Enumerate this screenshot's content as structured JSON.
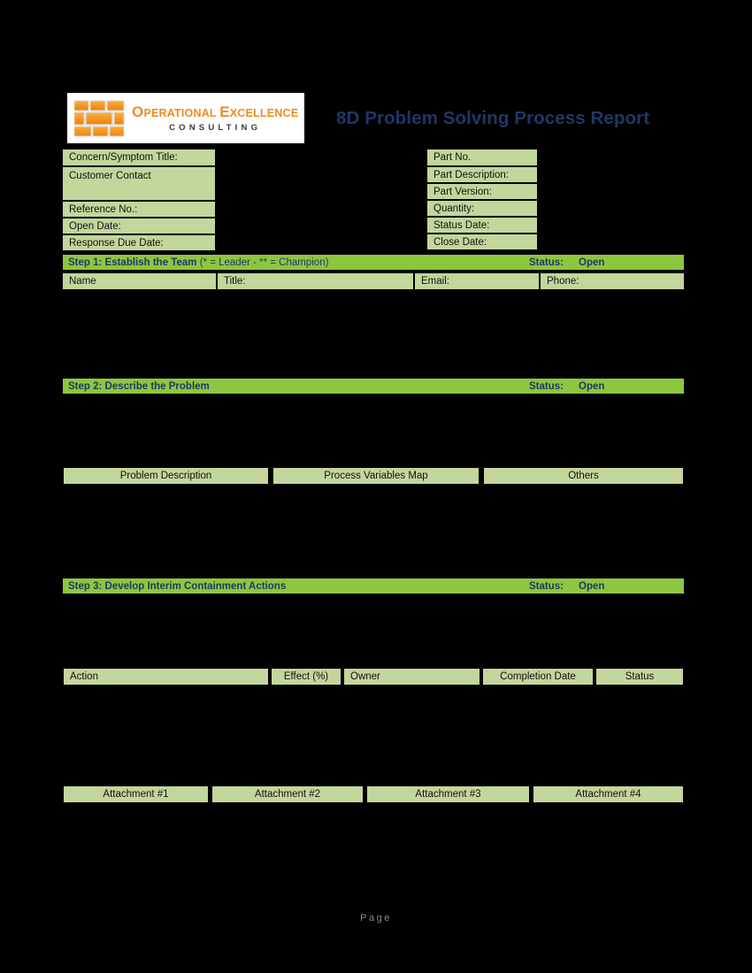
{
  "header": {
    "logo": {
      "company_line1_a": "O",
      "company_line1_b": "PERATIONAL ",
      "company_line1_c": "E",
      "company_line1_d": "XCELLENCE",
      "company_line2": "CONSULTING",
      "brand_color": "#F18A1E"
    },
    "report_title": "8D Problem Solving Process Report",
    "title_color": "#1F3864"
  },
  "info_left": [
    {
      "label": "Concern/Symptom Title:"
    },
    {
      "label": "Customer Contact"
    },
    {
      "label": "Reference No.:"
    },
    {
      "label": "Open Date:"
    },
    {
      "label": "Response Due Date:"
    }
  ],
  "info_right": [
    {
      "label": "Part No."
    },
    {
      "label": "Part Description:"
    },
    {
      "label": "Part Version:"
    },
    {
      "label": "Quantity:"
    },
    {
      "label": "Status Date:"
    },
    {
      "label": "Close Date:"
    }
  ],
  "steps": {
    "step1": {
      "title": "Step 1: Establish the Team ",
      "note": "(* = Leader - ** = Champion)",
      "status_label": "Status:",
      "status_value": "Open",
      "columns": [
        "Name",
        "Title:",
        "Email:",
        "Phone:"
      ]
    },
    "step2": {
      "title": "Step 2: Describe the Problem",
      "note": "",
      "status_label": "Status:",
      "status_value": "Open",
      "tabs": [
        "Problem Description",
        "Process Variables Map",
        "Others"
      ]
    },
    "step3": {
      "title": "Step 3: Develop Interim Containment Actions",
      "note": "",
      "status_label": "Status:",
      "status_value": "Open",
      "columns": [
        "Action",
        "Effect (%)",
        "Owner",
        "Completion Date",
        "Status"
      ]
    }
  },
  "attachments": [
    "Attachment #1",
    "Attachment #2",
    "Attachment #3",
    "Attachment #4"
  ],
  "footer": {
    "page_text": "Page"
  },
  "colors": {
    "step_bar_green": "#8DC63F",
    "cell_green": "#C3D69B",
    "navy": "#1F3864",
    "background": "#000000"
  }
}
